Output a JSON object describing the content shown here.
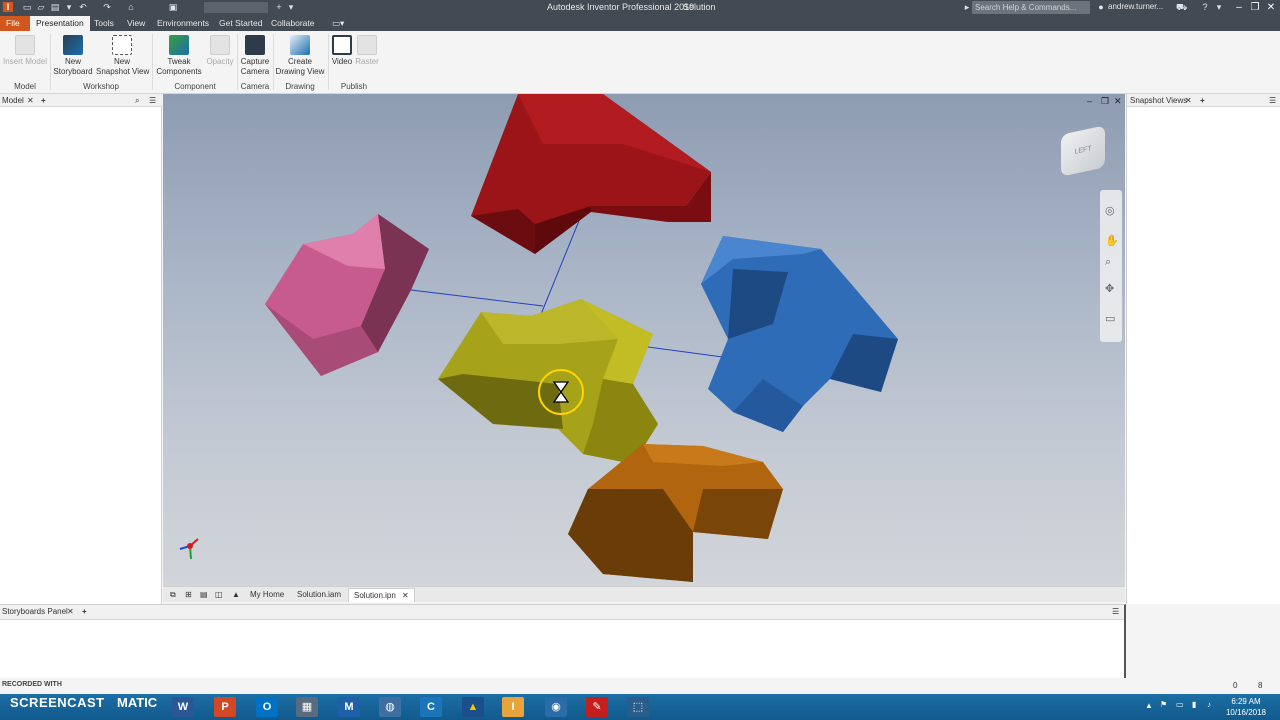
{
  "window": {
    "title": "Autodesk Inventor Professional 2019",
    "document_name": "Solution",
    "search_placeholder": "Search Help & Commands...",
    "user": "andrew.turner..."
  },
  "ribbon_tabs": [
    "File",
    "Presentation",
    "Tools",
    "View",
    "Environments",
    "Get Started",
    "Collaborate"
  ],
  "ribbon": {
    "insert_model": "Insert Model",
    "new_storyboard": [
      "New",
      "Storyboard"
    ],
    "new_snapshot": [
      "New",
      "Snapshot View"
    ],
    "tweak": [
      "Tweak",
      "Components"
    ],
    "opacity": "Opacity",
    "capture": [
      "Capture",
      "Camera"
    ],
    "drawing_view": [
      "Create",
      "Drawing View"
    ],
    "video": "Video",
    "raster": "Raster",
    "groups": [
      "Model",
      "Workshop",
      "Component",
      "Camera",
      "Drawing",
      "Publish"
    ]
  },
  "panels": {
    "model": "Model",
    "snapshot_views": "Snapshot Views",
    "storyboards": "Storyboards Panel"
  },
  "doc_tabs": [
    "My Home",
    "Solution.iam",
    "Solution.ipn"
  ],
  "viewcube_label": "LEFT",
  "statusbar": {
    "left_count": "0",
    "right_count": "8"
  },
  "watermark": {
    "recorded": "RECORDED WITH",
    "brand": "SCREENCAST",
    "brand2": "MATIC"
  },
  "taskbar": {
    "time": "6:29 AM",
    "date": "10/16/2018",
    "apps": [
      "W",
      "P",
      "O",
      "M",
      "C",
      "I"
    ]
  }
}
